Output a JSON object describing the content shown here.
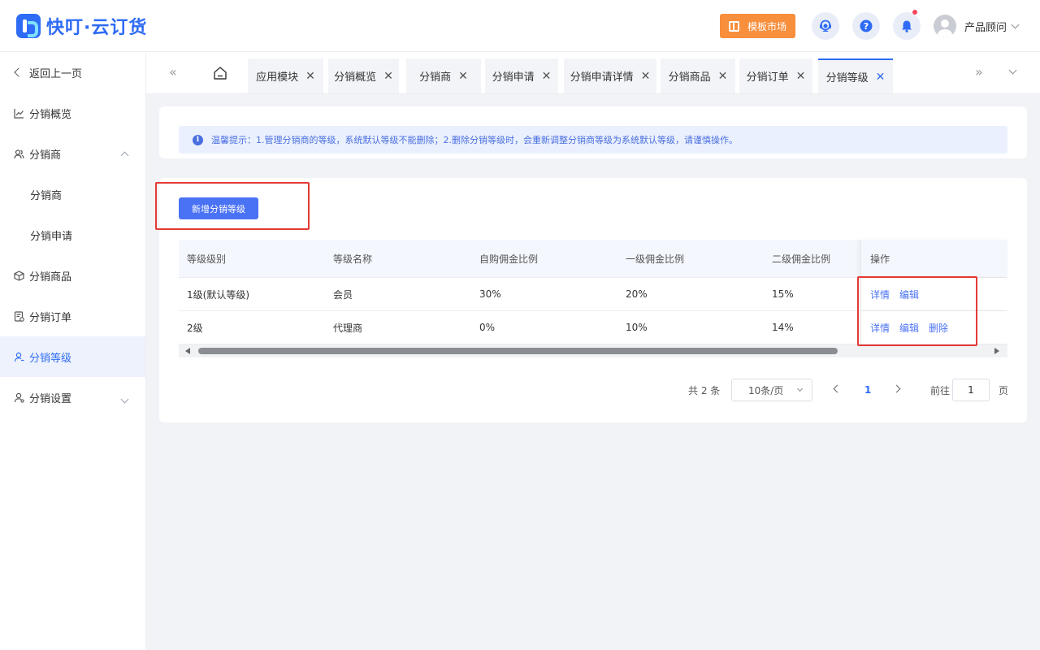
{
  "header": {
    "logo_text": "快叮·云订货",
    "template_market": "模板市场",
    "user_name": "产品顾问"
  },
  "colors": {
    "primary": "#2f6cf6",
    "template_button": "#f78f3d",
    "highlight": "#e53935"
  },
  "sidebar": {
    "back": "返回上一页",
    "items": [
      {
        "label": "分销概览",
        "icon": "chart-line-icon"
      },
      {
        "label": "分销商",
        "icon": "users-icon"
      },
      {
        "label": "分销商",
        "icon": ""
      },
      {
        "label": "分销申请",
        "icon": ""
      },
      {
        "label": "分销商品",
        "icon": "box-icon"
      },
      {
        "label": "分销订单",
        "icon": "order-icon"
      },
      {
        "label": "分销等级",
        "icon": "user-level-icon"
      },
      {
        "label": "分销设置",
        "icon": "user-settings-icon"
      }
    ]
  },
  "tabs": [
    "应用模块",
    "分销概览",
    "分销商",
    "分销申请",
    "分销申请详情",
    "分销商品",
    "分销订单",
    "分销等级"
  ],
  "active_tab": "分销等级",
  "notice": "温馨提示：1.管理分销商的等级，系统默认等级不能删除；2.删除分销等级时，会重新调整分销商等级为系统默认等级，请谨慎操作。",
  "add_button": "新增分销等级",
  "table": {
    "columns": [
      "等级级别",
      "等级名称",
      "自购佣金比例",
      "一级佣金比例",
      "二级佣金比例",
      "操作"
    ],
    "rows": [
      {
        "level": "1级(默认等级)",
        "name": "会员",
        "self_rate": "30%",
        "l1_rate": "20%",
        "l2_rate": "15%",
        "actions": [
          "详情",
          "编辑"
        ]
      },
      {
        "level": "2级",
        "name": "代理商",
        "self_rate": "0%",
        "l1_rate": "10%",
        "l2_rate": "14%",
        "actions": [
          "详情",
          "编辑",
          "删除"
        ]
      }
    ]
  },
  "pagination": {
    "total": "共 2 条",
    "page_size": "10条/页",
    "current_page": "1",
    "goto_label": "前往",
    "goto_value": "1",
    "page_suffix": "页"
  }
}
